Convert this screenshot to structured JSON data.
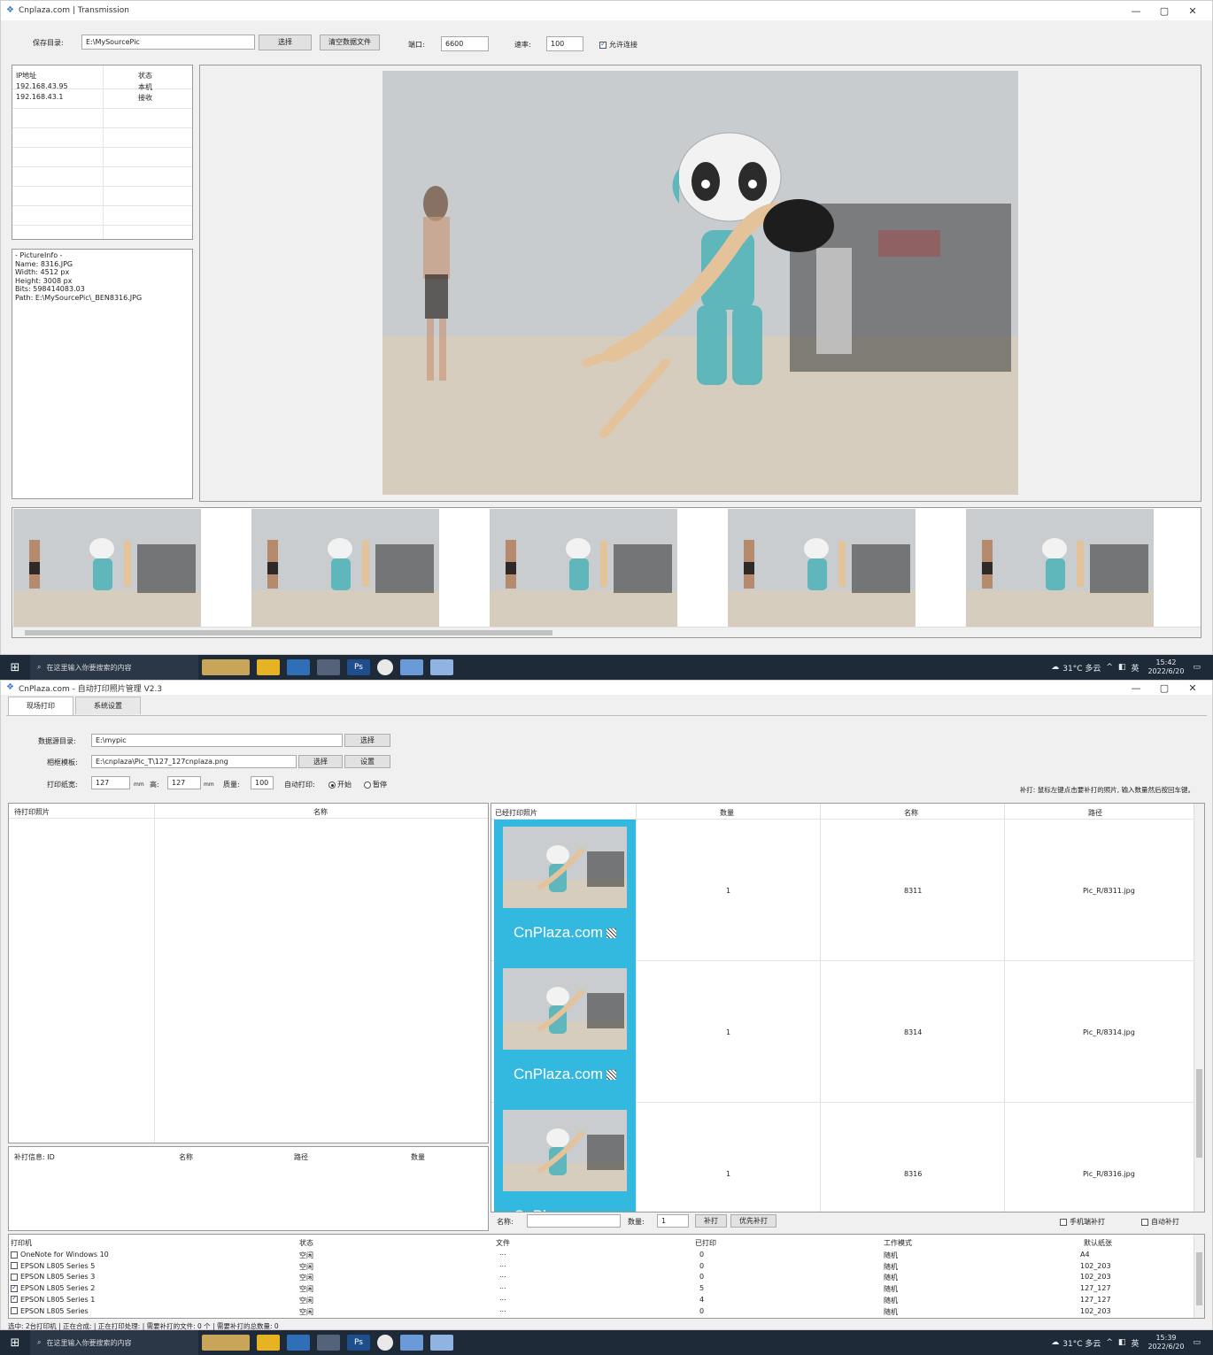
{
  "window1": {
    "title": "Cnplaza.com | Transmission",
    "controls": {
      "minimize": "—",
      "maximize": "▢",
      "close": "✕"
    },
    "toolbar": {
      "save_dir_label": "保存目录:",
      "save_dir_value": "E:\\MySourcePic",
      "select_button": "选择",
      "clear_button": "清空数据文件",
      "port_label": "端口:",
      "port_value": "6600",
      "rate_label": "速率:",
      "rate_value": "100",
      "allow_connect_label": "允许连接",
      "allow_connect_checked": true
    },
    "ip_table": {
      "headers": [
        "IP地址",
        "状态"
      ],
      "rows": [
        [
          "192.168.43.95",
          "本机"
        ],
        [
          "192.168.43.1",
          "接收"
        ]
      ]
    },
    "picture_info": {
      "lines": [
        "- PictureInfo -",
        "Name: 8316.JPG",
        "Width: 4512 px",
        "Height: 3008 px",
        "Bits: 598414083.03",
        "Path: E:\\MySourcePic\\_BEN8316.JPG"
      ]
    },
    "thumbnails_count": 5
  },
  "taskbar1": {
    "search_placeholder": "在这里输入你要搜索的内容",
    "weather": "31°C 多云",
    "ime": "英",
    "time": "15:42",
    "date": "2022/6/20"
  },
  "window2": {
    "title": "CnPlaza.com - 自动打印照片管理 V2.3",
    "controls": {
      "minimize": "—",
      "maximize": "▢",
      "close": "✕"
    },
    "tabs": [
      "现场打印",
      "系统设置"
    ],
    "form": {
      "data_dir_label": "数据源目录:",
      "data_dir_value": "E:\\mypic",
      "select_button": "选择",
      "template_label": "相框模板:",
      "template_value": "E:\\cnplaza\\Pic_T\\127_127cnplaza.png",
      "template_select": "选择",
      "template_settings": "设置",
      "paper_width_label": "打印纸宽:",
      "paper_width": "127",
      "unit_mm": "mm",
      "height_label": "高:",
      "paper_height": "127",
      "quality_label": "质量:",
      "quality": "100",
      "auto_print_label": "自动打印:",
      "auto_start": "开始",
      "auto_pause": "暂停",
      "reprint_hint": "补打: 鼠标左键点击要补打的照片, 输入数量然后按回车键。"
    },
    "pending": {
      "headers": [
        "待打印照片",
        "名称"
      ]
    },
    "reprint_info": {
      "headers": [
        "补打信息: ID",
        "名称",
        "路径",
        "数量"
      ]
    },
    "printed": {
      "headers": [
        "已经打印照片",
        "数量",
        "名称",
        "路径"
      ],
      "brand": "CnPlaza.com",
      "rows": [
        {
          "qty": "1",
          "name": "8311",
          "path": "Pic_R/8311.jpg"
        },
        {
          "qty": "1",
          "name": "8314",
          "path": "Pic_R/8314.jpg"
        },
        {
          "qty": "1",
          "name": "8316",
          "path": "Pic_R/8316.jpg"
        }
      ]
    },
    "reprint_bar": {
      "name_label": "名称:",
      "qty_label": "数量:",
      "qty_value": "1",
      "reprint_button": "补打",
      "priority_button": "优先补打",
      "phone_reprint": "手机端补打",
      "auto_reprint": "自动补打"
    },
    "printers": {
      "headers": [
        "打印机",
        "状态",
        "文件",
        "已打印",
        "工作模式",
        "默认纸张"
      ],
      "rows": [
        {
          "checked": false,
          "name": "OneNote for Windows 10",
          "status": "空闲",
          "file": "...",
          "printed": "0",
          "mode": "随机",
          "paper": "A4"
        },
        {
          "checked": false,
          "name": "EPSON L805 Series 5",
          "status": "空闲",
          "file": "...",
          "printed": "0",
          "mode": "随机",
          "paper": "102_203"
        },
        {
          "checked": false,
          "name": "EPSON L805 Series 3",
          "status": "空闲",
          "file": "...",
          "printed": "0",
          "mode": "随机",
          "paper": "102_203"
        },
        {
          "checked": true,
          "name": "EPSON L805 Series 2",
          "status": "空闲",
          "file": "...",
          "printed": "5",
          "mode": "随机",
          "paper": "127_127"
        },
        {
          "checked": true,
          "name": "EPSON L805 Series 1",
          "status": "空闲",
          "file": "...",
          "printed": "4",
          "mode": "随机",
          "paper": "127_127"
        },
        {
          "checked": false,
          "name": "EPSON L805 Series",
          "status": "空闲",
          "file": "...",
          "printed": "0",
          "mode": "随机",
          "paper": "102_203"
        }
      ]
    },
    "status_bar": "选中: 2台打印机 | 正在合成: | 正在打印处理: | 需要补打的文件: 0 个 | 需要补打的总数量: 0"
  },
  "taskbar2": {
    "search_placeholder": "在这里输入你要搜索的内容",
    "weather": "31°C 多云",
    "ime": "英",
    "time": "15:39",
    "date": "2022/6/20"
  },
  "colors": {
    "accent_cyan": "#33b8e0",
    "taskbar": "#1f2a38",
    "window_bg": "#f0f0f0"
  }
}
